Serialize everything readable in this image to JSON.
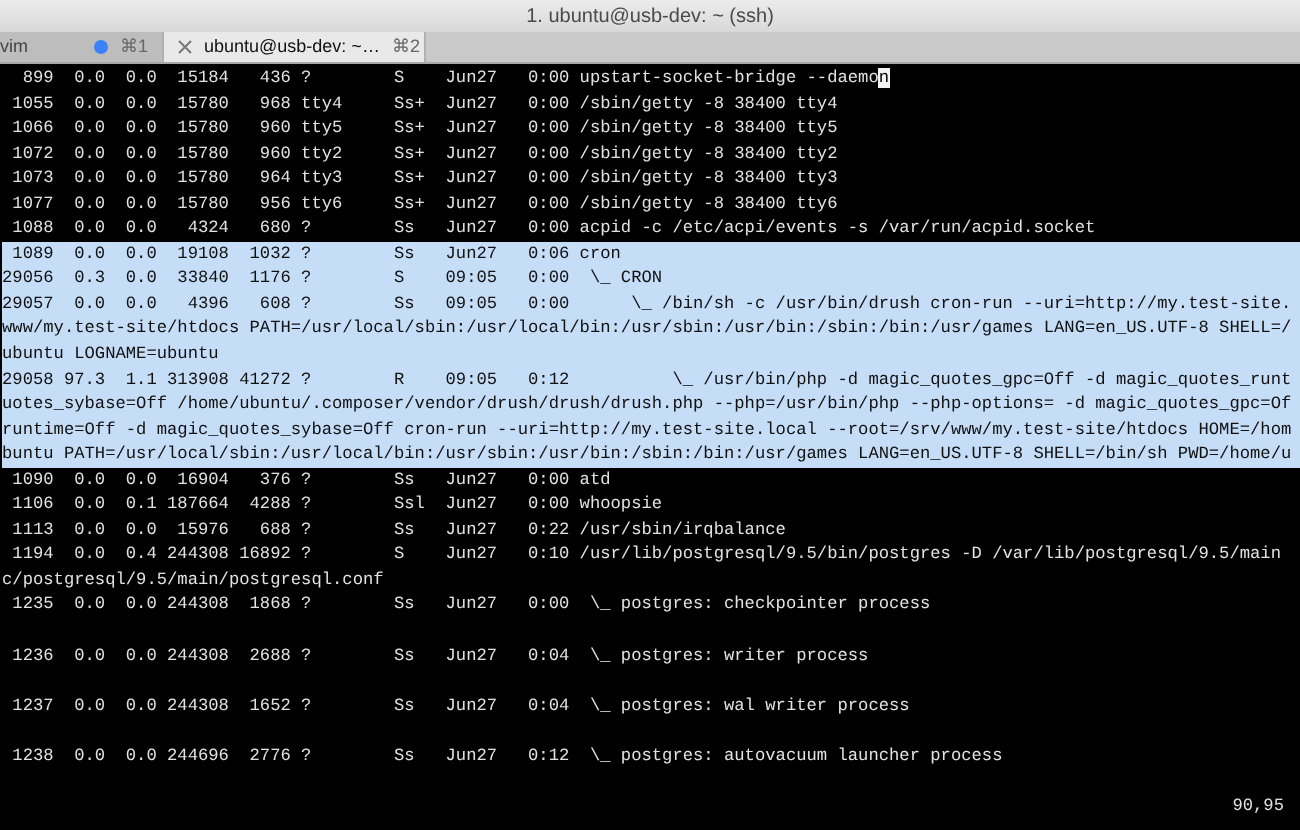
{
  "window": {
    "title": "1. ubuntu@usb-dev: ~ (ssh)"
  },
  "tabs": [
    {
      "label": "vim",
      "shortcut": "⌘1",
      "selected": false,
      "activity": true
    },
    {
      "label": "ubuntu@usb-dev: ~…",
      "shortcut": "⌘2",
      "selected": true,
      "activity": false
    }
  ],
  "terminal": {
    "lines": [
      {
        "kind": "text",
        "selected": false,
        "text": "  899  0.0  0.0  15184   436 ?        S    Jun27   0:00 upstart-socket-bridge --daemo",
        "cursor": "n"
      },
      {
        "kind": "text",
        "selected": false,
        "text": " 1055  0.0  0.0  15780   968 tty4     Ss+  Jun27   0:00 /sbin/getty -8 38400 tty4"
      },
      {
        "kind": "text",
        "selected": false,
        "text": " 1066  0.0  0.0  15780   960 tty5     Ss+  Jun27   0:00 /sbin/getty -8 38400 tty5"
      },
      {
        "kind": "text",
        "selected": false,
        "text": " 1072  0.0  0.0  15780   960 tty2     Ss+  Jun27   0:00 /sbin/getty -8 38400 tty2"
      },
      {
        "kind": "text",
        "selected": false,
        "text": " 1073  0.0  0.0  15780   964 tty3     Ss+  Jun27   0:00 /sbin/getty -8 38400 tty3"
      },
      {
        "kind": "text",
        "selected": false,
        "text": " 1077  0.0  0.0  15780   956 tty6     Ss+  Jun27   0:00 /sbin/getty -8 38400 tty6"
      },
      {
        "kind": "text",
        "selected": false,
        "text": " 1088  0.0  0.0   4324   680 ?        Ss   Jun27   0:00 acpid -c /etc/acpi/events -s /var/run/acpid.socket"
      },
      {
        "kind": "text",
        "selected": true,
        "text": " 1089  0.0  0.0  19108  1032 ?        Ss   Jun27   0:06 cron"
      },
      {
        "kind": "text",
        "selected": true,
        "text": "29056  0.3  0.0  33840  1176 ?        S    09:05   0:00  \\_ CRON"
      },
      {
        "kind": "text",
        "selected": true,
        "text": "29057  0.0  0.0   4396   608 ?        Ss   09:05   0:00      \\_ /bin/sh -c /usr/bin/drush cron-run --uri=http://my.test-site."
      },
      {
        "kind": "text",
        "selected": true,
        "text": "www/my.test-site/htdocs PATH=/usr/local/sbin:/usr/local/bin:/usr/sbin:/usr/bin:/sbin:/bin:/usr/games LANG=en_US.UTF-8 SHELL=/"
      },
      {
        "kind": "text",
        "selected": true,
        "text": "ubuntu LOGNAME=ubuntu"
      },
      {
        "kind": "text",
        "selected": true,
        "text": "29058 97.3  1.1 313908 41272 ?        R    09:05   0:12          \\_ /usr/bin/php -d magic_quotes_gpc=Off -d magic_quotes_runt"
      },
      {
        "kind": "text",
        "selected": true,
        "text": "uotes_sybase=Off /home/ubuntu/.composer/vendor/drush/drush/drush.php --php=/usr/bin/php --php-options= -d magic_quotes_gpc=Of"
      },
      {
        "kind": "text",
        "selected": true,
        "text": "runtime=Off -d magic_quotes_sybase=Off cron-run --uri=http://my.test-site.local --root=/srv/www/my.test-site/htdocs HOME=/hom"
      },
      {
        "kind": "text",
        "selected": true,
        "text": "buntu PATH=/usr/local/sbin:/usr/local/bin:/usr/sbin:/usr/bin:/sbin:/bin:/usr/games LANG=en_US.UTF-8 SHELL=/bin/sh PWD=/home/u"
      },
      {
        "kind": "text",
        "selected": false,
        "text": " 1090  0.0  0.0  16904   376 ?        Ss   Jun27   0:00 atd"
      },
      {
        "kind": "text",
        "selected": false,
        "text": " 1106  0.0  0.1 187664  4288 ?        Ssl  Jun27   0:00 whoopsie"
      },
      {
        "kind": "text",
        "selected": false,
        "text": " 1113  0.0  0.0  15976   688 ?        Ss   Jun27   0:22 /usr/sbin/irqbalance"
      },
      {
        "kind": "text",
        "selected": false,
        "text": " 1194  0.0  0.4 244308 16892 ?        S    Jun27   0:10 /usr/lib/postgresql/9.5/bin/postgres -D /var/lib/postgresql/9.5/main"
      },
      {
        "kind": "text",
        "selected": false,
        "text": "c/postgresql/9.5/main/postgresql.conf"
      },
      {
        "kind": "text",
        "selected": false,
        "text": " 1235  0.0  0.0 244308  1868 ?        Ss   Jun27   0:00  \\_ postgres: checkpointer process"
      },
      {
        "kind": "blank"
      },
      {
        "kind": "text",
        "selected": false,
        "text": " 1236  0.0  0.0 244308  2688 ?        Ss   Jun27   0:04  \\_ postgres: writer process"
      },
      {
        "kind": "blank"
      },
      {
        "kind": "text",
        "selected": false,
        "text": " 1237  0.0  0.0 244308  1652 ?        Ss   Jun27   0:04  \\_ postgres: wal writer process"
      },
      {
        "kind": "blank"
      },
      {
        "kind": "text",
        "selected": false,
        "text": " 1238  0.0  0.0 244696  2776 ?        Ss   Jun27   0:12  \\_ postgres: autovacuum launcher process"
      },
      {
        "kind": "blank"
      }
    ],
    "status": "90,95"
  }
}
